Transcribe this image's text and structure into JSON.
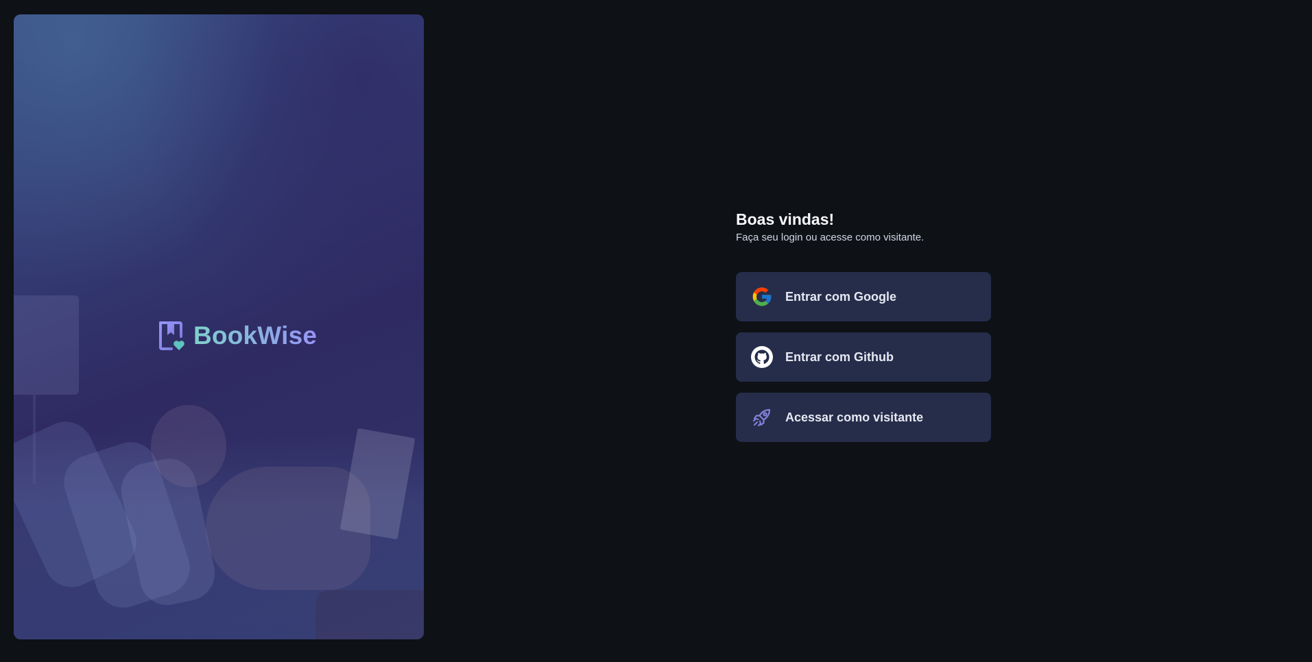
{
  "brand": {
    "name": "BookWise"
  },
  "login": {
    "title": "Boas vindas!",
    "subtitle": "Faça seu login ou acesse como visitante.",
    "buttons": {
      "google": {
        "label": "Entrar com Google",
        "icon": "google-icon"
      },
      "github": {
        "label": "Entrar com Github",
        "icon": "github-icon"
      },
      "guest": {
        "label": "Acessar como visitante",
        "icon": "rocket-icon"
      }
    }
  },
  "colors": {
    "background": "#0e1116",
    "button": "#252d4a",
    "brand_gradient_start": "#7fd1cc",
    "brand_gradient_end": "#9694f5"
  }
}
